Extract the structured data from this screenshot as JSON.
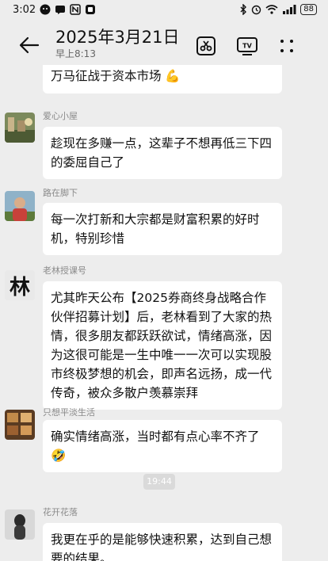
{
  "status_bar": {
    "time": "3:02",
    "battery": "88"
  },
  "header": {
    "title": "2025年3月21日",
    "subtitle": "早上8:13"
  },
  "messages": [
    {
      "sender": "",
      "text": "万马征战于资本市场 💪"
    },
    {
      "sender": "爱心小屋",
      "text": "趁现在多赚一点，这辈子不想再低三下四的委屈自己了"
    },
    {
      "sender": "路在脚下",
      "text": "每一次打新和大宗都是财富积累的好时机，特别珍惜"
    },
    {
      "sender": "老林授课号",
      "text": "尤其昨天公布【2025券商终身战略合作伙伴招募计划】后，老林看到了大家的热情，很多朋友都跃跃欲试，情绪高涨，因为这很可能是一生中唯一一次可以实现股市终极梦想的机会，即声名远扬，成一代传奇，被众多散户羡慕崇拜",
      "avatar_text": "林"
    },
    {
      "sender": "只想平淡生活",
      "text": "确实情绪高涨，当时都有点心率不齐了🤣"
    },
    {
      "sender": "花开花落",
      "text": "我更在乎的是能够快速积累，达到自己想要的结果。"
    }
  ],
  "time_divider": "19:44",
  "colors": {
    "background": "#ededed",
    "bubble": "#ffffff",
    "sender": "#8a8a8a"
  },
  "icons": [
    "back-arrow-icon",
    "scissors-icon",
    "tv-icon",
    "more-icon"
  ]
}
